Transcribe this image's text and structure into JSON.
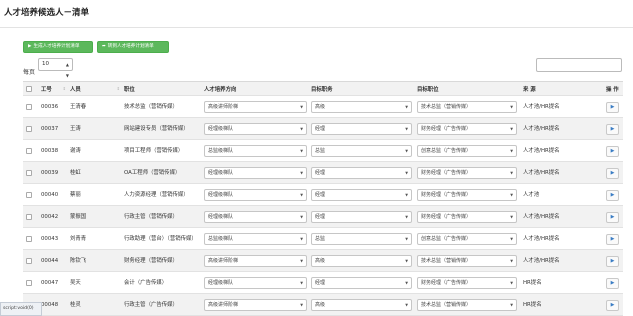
{
  "page": {
    "title": "人才培养候选人－清单"
  },
  "toolbar": {
    "generate_label": "生成人才培养计划清单",
    "generate_icon": "play-icon",
    "switch_label": "转到人才培养计划清单",
    "switch_icon": "share-icon"
  },
  "per_page": {
    "label": "每页",
    "value": "10"
  },
  "search": {
    "placeholder": ""
  },
  "columns": {
    "id": "工号",
    "name": "人员",
    "position": "职位",
    "direction": "人才培养方向",
    "target_rank": "目标职务",
    "target_position": "目标职位",
    "source": "来 源",
    "action": "操 作"
  },
  "rows": [
    {
      "id": "00036",
      "name": "王清春",
      "position": "技术总监（营销传媒）",
      "direction": "高级讲师阶梯",
      "target_rank": "高级",
      "target_position": "技术总监（营销传媒）",
      "source": "人才池/HR提名"
    },
    {
      "id": "00037",
      "name": "王涛",
      "position": "网站建设专员（营销传媒）",
      "direction": "经理级梯队",
      "target_rank": "经理",
      "target_position": "财务经理（广告传媒）",
      "source": "人才池/HR提名"
    },
    {
      "id": "00038",
      "name": "谢涛",
      "position": "项目工程师（营销传媒）",
      "direction": "总监级梯队",
      "target_rank": "总监",
      "target_position": "创意总监（广告传媒）",
      "source": "人才池/HR提名"
    },
    {
      "id": "00039",
      "name": "桂虹",
      "position": "OA工程师（营销传媒）",
      "direction": "经理级梯队",
      "target_rank": "经理",
      "target_position": "财务经理（广告传媒）",
      "source": "人才池/HR提名"
    },
    {
      "id": "00040",
      "name": "蔡丽",
      "position": "人力资源经理（营销传媒）",
      "direction": "经理级梯队",
      "target_rank": "经理",
      "target_position": "财务经理（广告传媒）",
      "source": "人才池"
    },
    {
      "id": "00042",
      "name": "蒙振国",
      "position": "行政主管（营销传媒）",
      "direction": "经理级梯队",
      "target_rank": "经理",
      "target_position": "财务经理（广告传媒）",
      "source": "人才池/HR提名"
    },
    {
      "id": "00043",
      "name": "刘青青",
      "position": "行政助理（营台）（营销传媒）",
      "direction": "总监级梯队",
      "target_rank": "总监",
      "target_position": "创意总监（广告传媒）",
      "source": "人才池/HR提名"
    },
    {
      "id": "00044",
      "name": "陈钦飞",
      "position": "财务经理（营销传媒）",
      "direction": "高级讲师阶梯",
      "target_rank": "高级",
      "target_position": "技术总监（营销传媒）",
      "source": "人才池/HR提名"
    },
    {
      "id": "00047",
      "name": "吴天",
      "position": "会计（广告传媒）",
      "direction": "经理级梯队",
      "target_rank": "经理",
      "target_position": "财务经理（广告传媒）",
      "source": "HR提名"
    },
    {
      "id": "00048",
      "name": "桂灵",
      "position": "行政主管（广告传媒）",
      "direction": "高级讲师阶梯",
      "target_rank": "高级",
      "target_position": "技术总监（营销传媒）",
      "source": "HR提名"
    }
  ],
  "statusbar": {
    "text": "script:void(0)"
  }
}
